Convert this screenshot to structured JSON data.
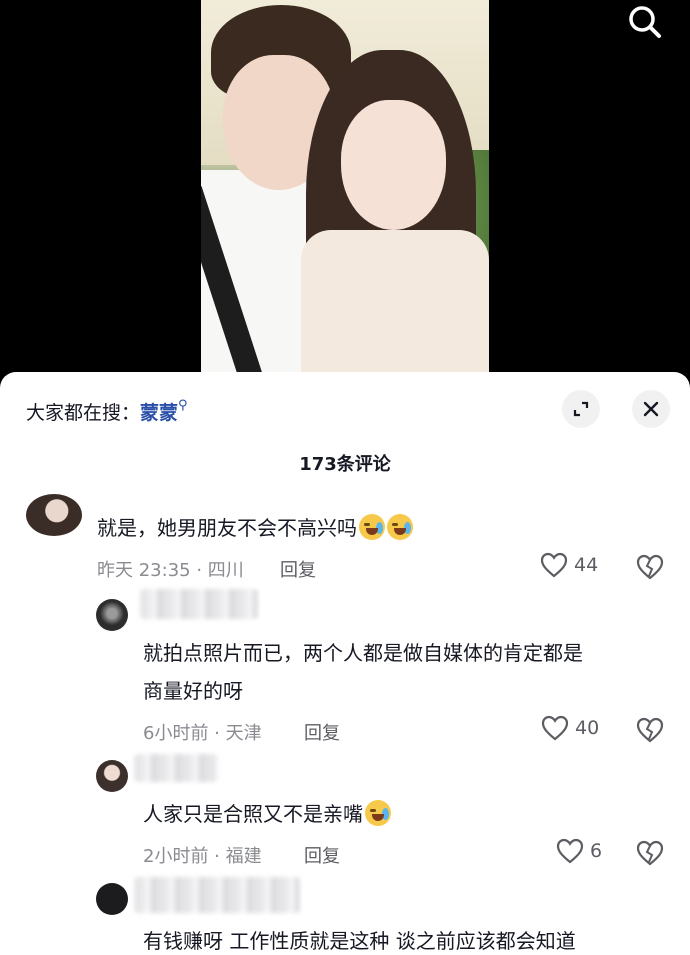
{
  "video": {
    "image_alt": "couple selfie photo",
    "search_icon": "search-icon"
  },
  "sheet": {
    "trending_prefix": "大家都在搜：",
    "trending_term": "蒙蒙",
    "expand_icon": "expand-icon",
    "close_icon": "close-icon",
    "comment_count": "173条评论"
  },
  "comments": [
    {
      "text": "就是，她男朋友不会不高兴吗",
      "emojis": 2,
      "meta": "昨天 23:35 · 四川",
      "reply_label": "回复",
      "likes": "44"
    },
    {
      "text_line1": "就拍点照片而已，两个人都是做自媒体的肯定都是",
      "text_line2": "商量好的呀",
      "meta": "6小时前 · 天津",
      "reply_label": "回复",
      "likes": "40"
    },
    {
      "text": "人家只是合照又不是亲嘴",
      "emojis": 1,
      "meta": "2小时前 · 福建",
      "reply_label": "回复",
      "likes": "6"
    },
    {
      "text": "有钱赚呀 工作性质就是这种 谈之前应该都会知道"
    }
  ],
  "colors": {
    "link_blue": "#2a4fa8",
    "meta_gray": "#8a8b91",
    "text": "#161823"
  }
}
